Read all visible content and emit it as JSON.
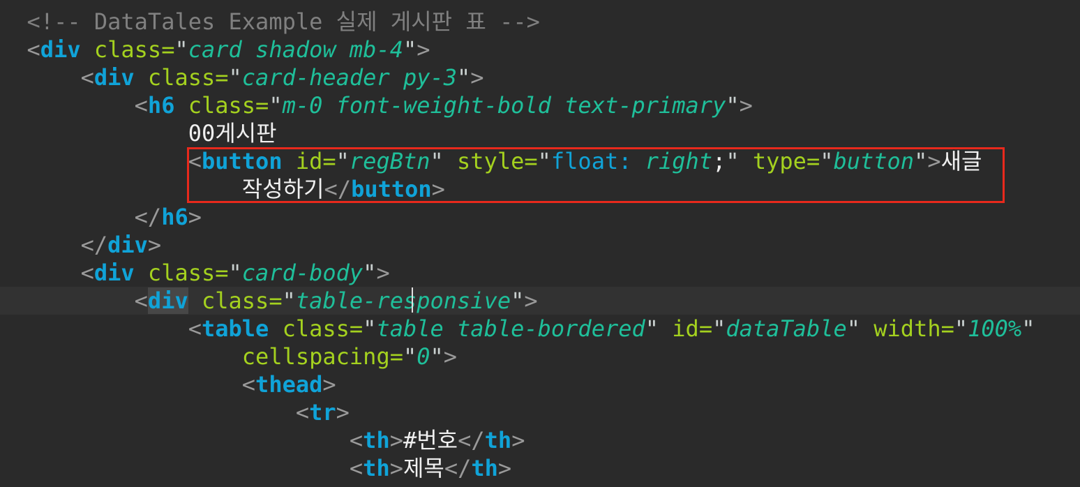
{
  "editor": {
    "lines": [
      {
        "indent": "  ",
        "tokens": [
          {
            "t": "<!-- DataTales Example 실제 게시판 표 -->",
            "c": "c-comment"
          }
        ]
      },
      {
        "indent": "  ",
        "tokens": [
          {
            "t": "<",
            "c": "c-punct"
          },
          {
            "t": "div",
            "c": "c-tag"
          },
          {
            "t": " ",
            "c": "c-text"
          },
          {
            "t": "class",
            "c": "c-attr"
          },
          {
            "t": "=",
            "c": "c-attr"
          },
          {
            "t": "\"",
            "c": "c-quote"
          },
          {
            "t": "card shadow mb-4",
            "c": "c-str"
          },
          {
            "t": "\"",
            "c": "c-quote"
          },
          {
            "t": ">",
            "c": "c-punct"
          }
        ]
      },
      {
        "indent": "      ",
        "tokens": [
          {
            "t": "<",
            "c": "c-punct"
          },
          {
            "t": "div",
            "c": "c-tag"
          },
          {
            "t": " ",
            "c": "c-text"
          },
          {
            "t": "class",
            "c": "c-attr"
          },
          {
            "t": "=",
            "c": "c-attr"
          },
          {
            "t": "\"",
            "c": "c-quote"
          },
          {
            "t": "card-header py-3",
            "c": "c-str"
          },
          {
            "t": "\"",
            "c": "c-quote"
          },
          {
            "t": ">",
            "c": "c-punct"
          }
        ]
      },
      {
        "indent": "          ",
        "tokens": [
          {
            "t": "<",
            "c": "c-punct"
          },
          {
            "t": "h6",
            "c": "c-tag"
          },
          {
            "t": " ",
            "c": "c-text"
          },
          {
            "t": "class",
            "c": "c-attr"
          },
          {
            "t": "=",
            "c": "c-attr"
          },
          {
            "t": "\"",
            "c": "c-quote"
          },
          {
            "t": "m-0 font-weight-bold text-primary",
            "c": "c-str"
          },
          {
            "t": "\"",
            "c": "c-quote"
          },
          {
            "t": ">",
            "c": "c-punct"
          }
        ]
      },
      {
        "indent": "              ",
        "tokens": [
          {
            "t": "00게시판",
            "c": "c-text"
          }
        ]
      },
      {
        "indent": "              ",
        "tokens": [
          {
            "t": "<",
            "c": "c-punct"
          },
          {
            "t": "button",
            "c": "c-tag"
          },
          {
            "t": " ",
            "c": "c-text"
          },
          {
            "t": "id",
            "c": "c-attr"
          },
          {
            "t": "=",
            "c": "c-attr"
          },
          {
            "t": "\"",
            "c": "c-quote"
          },
          {
            "t": "regBtn",
            "c": "c-str"
          },
          {
            "t": "\"",
            "c": "c-quote"
          },
          {
            "t": " ",
            "c": "c-text"
          },
          {
            "t": "style",
            "c": "c-attr"
          },
          {
            "t": "=",
            "c": "c-attr"
          },
          {
            "t": "\"",
            "c": "c-quote"
          },
          {
            "t": "float",
            "c": "c-cssprop"
          },
          {
            "t": ": ",
            "c": "c-cssprop"
          },
          {
            "t": "right",
            "c": "c-str"
          },
          {
            "t": ";",
            "c": "c-text"
          },
          {
            "t": "\"",
            "c": "c-quote"
          },
          {
            "t": " ",
            "c": "c-text"
          },
          {
            "t": "type",
            "c": "c-attr"
          },
          {
            "t": "=",
            "c": "c-attr"
          },
          {
            "t": "\"",
            "c": "c-quote"
          },
          {
            "t": "button",
            "c": "c-str"
          },
          {
            "t": "\"",
            "c": "c-quote"
          },
          {
            "t": ">",
            "c": "c-punct"
          },
          {
            "t": "새글",
            "c": "c-text"
          }
        ]
      },
      {
        "indent": "                  ",
        "tokens": [
          {
            "t": "작성하기",
            "c": "c-text"
          },
          {
            "t": "</",
            "c": "c-punct"
          },
          {
            "t": "button",
            "c": "c-tag"
          },
          {
            "t": ">",
            "c": "c-punct"
          }
        ]
      },
      {
        "indent": "          ",
        "tokens": [
          {
            "t": "</",
            "c": "c-punct"
          },
          {
            "t": "h6",
            "c": "c-tag"
          },
          {
            "t": ">",
            "c": "c-punct"
          }
        ]
      },
      {
        "indent": "      ",
        "tokens": [
          {
            "t": "</",
            "c": "c-punct"
          },
          {
            "t": "div",
            "c": "c-tag"
          },
          {
            "t": ">",
            "c": "c-punct"
          }
        ]
      },
      {
        "indent": "      ",
        "tokens": [
          {
            "t": "<",
            "c": "c-punct"
          },
          {
            "t": "div",
            "c": "c-tag"
          },
          {
            "t": " ",
            "c": "c-text"
          },
          {
            "t": "class",
            "c": "c-attr"
          },
          {
            "t": "=",
            "c": "c-attr"
          },
          {
            "t": "\"",
            "c": "c-quote"
          },
          {
            "t": "card-body",
            "c": "c-str"
          },
          {
            "t": "\"",
            "c": "c-quote"
          },
          {
            "t": ">",
            "c": "c-punct"
          }
        ]
      },
      {
        "indent": "          ",
        "current": true,
        "tokens": [
          {
            "t": "<",
            "c": "c-punct"
          },
          {
            "t": "div",
            "c": "c-tag c-tag-hl"
          },
          {
            "t": " ",
            "c": "c-text"
          },
          {
            "t": "class",
            "c": "c-attr"
          },
          {
            "t": "=",
            "c": "c-attr"
          },
          {
            "t": "\"",
            "c": "c-quote"
          },
          {
            "t": "table-responsive",
            "c": "c-str"
          },
          {
            "t": "\"",
            "c": "c-quote"
          },
          {
            "t": ">",
            "c": "c-punct"
          }
        ]
      },
      {
        "indent": "              ",
        "tokens": [
          {
            "t": "<",
            "c": "c-punct"
          },
          {
            "t": "table",
            "c": "c-tag"
          },
          {
            "t": " ",
            "c": "c-text"
          },
          {
            "t": "class",
            "c": "c-attr"
          },
          {
            "t": "=",
            "c": "c-attr"
          },
          {
            "t": "\"",
            "c": "c-quote"
          },
          {
            "t": "table table-bordered",
            "c": "c-str"
          },
          {
            "t": "\"",
            "c": "c-quote"
          },
          {
            "t": " ",
            "c": "c-text"
          },
          {
            "t": "id",
            "c": "c-attr"
          },
          {
            "t": "=",
            "c": "c-attr"
          },
          {
            "t": "\"",
            "c": "c-quote"
          },
          {
            "t": "dataTable",
            "c": "c-str"
          },
          {
            "t": "\"",
            "c": "c-quote"
          },
          {
            "t": " ",
            "c": "c-text"
          },
          {
            "t": "width",
            "c": "c-attr"
          },
          {
            "t": "=",
            "c": "c-attr"
          },
          {
            "t": "\"",
            "c": "c-quote"
          },
          {
            "t": "100%",
            "c": "c-str"
          },
          {
            "t": "\"",
            "c": "c-quote"
          }
        ]
      },
      {
        "indent": "                  ",
        "tokens": [
          {
            "t": "cellspacing",
            "c": "c-attr"
          },
          {
            "t": "=",
            "c": "c-attr"
          },
          {
            "t": "\"",
            "c": "c-quote"
          },
          {
            "t": "0",
            "c": "c-str"
          },
          {
            "t": "\"",
            "c": "c-quote"
          },
          {
            "t": ">",
            "c": "c-punct"
          }
        ]
      },
      {
        "indent": "                  ",
        "tokens": [
          {
            "t": "<",
            "c": "c-punct"
          },
          {
            "t": "thead",
            "c": "c-tag"
          },
          {
            "t": ">",
            "c": "c-punct"
          }
        ]
      },
      {
        "indent": "                      ",
        "tokens": [
          {
            "t": "<",
            "c": "c-punct"
          },
          {
            "t": "tr",
            "c": "c-tag"
          },
          {
            "t": ">",
            "c": "c-punct"
          }
        ]
      },
      {
        "indent": "                          ",
        "tokens": [
          {
            "t": "<",
            "c": "c-punct"
          },
          {
            "t": "th",
            "c": "c-tag"
          },
          {
            "t": ">",
            "c": "c-punct"
          },
          {
            "t": "#번호",
            "c": "c-text"
          },
          {
            "t": "</",
            "c": "c-punct"
          },
          {
            "t": "th",
            "c": "c-tag"
          },
          {
            "t": ">",
            "c": "c-punct"
          }
        ]
      },
      {
        "indent": "                          ",
        "tokens": [
          {
            "t": "<",
            "c": "c-punct"
          },
          {
            "t": "th",
            "c": "c-tag"
          },
          {
            "t": ">",
            "c": "c-punct"
          },
          {
            "t": "제목",
            "c": "c-text"
          },
          {
            "t": "</",
            "c": "c-punct"
          },
          {
            "t": "th",
            "c": "c-tag"
          },
          {
            "t": ">",
            "c": "c-punct"
          }
        ]
      }
    ]
  }
}
